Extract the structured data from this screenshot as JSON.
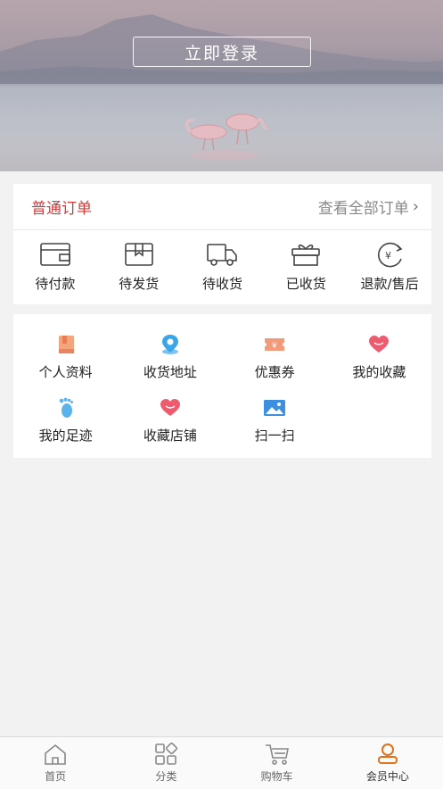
{
  "header": {
    "login_label": "立即登录"
  },
  "orders": {
    "title": "普通订单",
    "view_all": "查看全部订单",
    "items": [
      {
        "label": "待付款",
        "icon": "wallet-icon"
      },
      {
        "label": "待发货",
        "icon": "package-icon"
      },
      {
        "label": "待收货",
        "icon": "truck-icon"
      },
      {
        "label": "已收货",
        "icon": "gift-box-icon"
      },
      {
        "label": "退款/售后",
        "icon": "refund-yen-icon"
      }
    ]
  },
  "services": {
    "items": [
      {
        "label": "个人资料",
        "icon": "profile-book-icon"
      },
      {
        "label": "收货地址",
        "icon": "location-pin-icon"
      },
      {
        "label": "优惠券",
        "icon": "coupon-icon"
      },
      {
        "label": "我的收藏",
        "icon": "heart-icon"
      },
      {
        "label": "我的足迹",
        "icon": "footprint-icon"
      },
      {
        "label": "收藏店铺",
        "icon": "heart-shop-icon"
      },
      {
        "label": "扫一扫",
        "icon": "scan-image-icon"
      }
    ]
  },
  "tabbar": {
    "items": [
      {
        "label": "首页",
        "icon": "home-icon"
      },
      {
        "label": "分类",
        "icon": "category-grid-icon"
      },
      {
        "label": "购物车",
        "icon": "cart-icon"
      },
      {
        "label": "会员中心",
        "icon": "member-icon"
      }
    ],
    "active_index": 3
  },
  "colors": {
    "accent_red": "#d23b3b",
    "active_orange": "#e0701c",
    "coupon_orange": "#f39a7b",
    "heart_red": "#ee5a6e",
    "pin_blue": "#3aa6e8",
    "scan_blue": "#3d8fe0"
  }
}
